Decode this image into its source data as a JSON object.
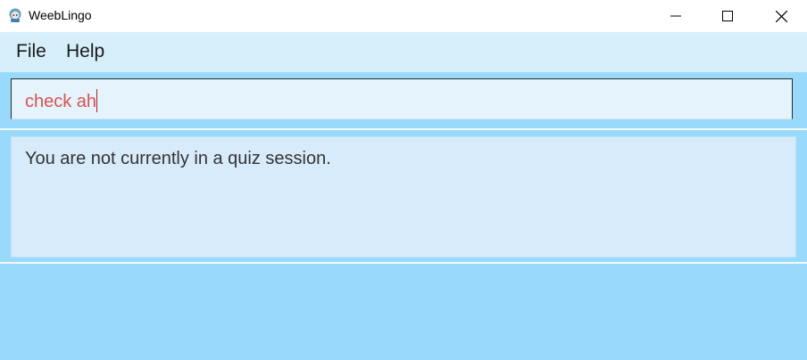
{
  "window": {
    "title": "WeebLingo",
    "icon": "weeblingo-app-icon",
    "controls": [
      "minimize-icon",
      "maximize-icon",
      "close-icon"
    ]
  },
  "menu": {
    "items": [
      "File",
      "Help"
    ]
  },
  "command": {
    "value": "check ah"
  },
  "result": {
    "message": "You are not currently in a quiz session."
  },
  "colors": {
    "background": "#99d9fb",
    "menubar": "#d6effb",
    "command_box": "#e5f3fd",
    "command_text": "#d9534f",
    "result_box": "#d8ebfb"
  }
}
